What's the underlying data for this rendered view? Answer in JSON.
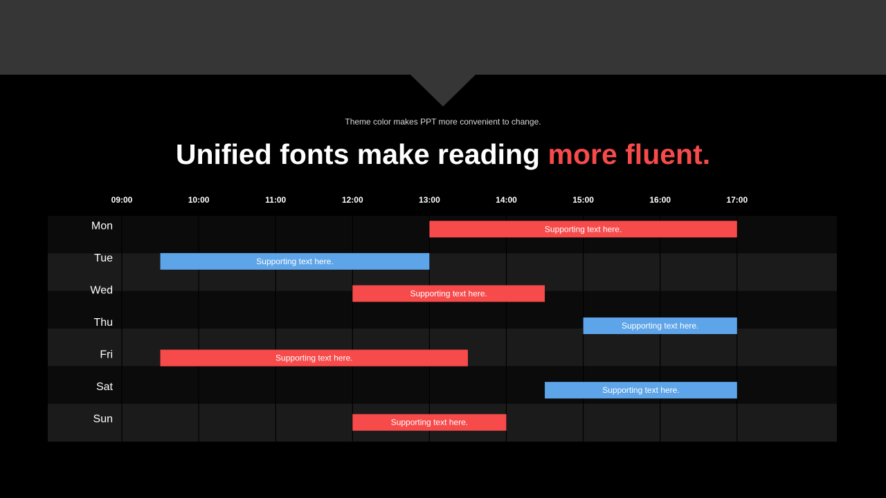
{
  "slide": {
    "subtitle": "Theme color makes PPT more convenient to change.",
    "title_plain": "Unified fonts make reading ",
    "title_accent": "more fluent."
  },
  "colors": {
    "accent_red": "#f74a4b",
    "accent_blue": "#5ea4e8",
    "band_dark": "#0b0b0b",
    "band_light": "#1b1b1b",
    "header_band": "#363636"
  },
  "chart_data": {
    "type": "gantt",
    "title": "Unified fonts make reading more fluent.",
    "x_ticks": [
      "09:00",
      "10:00",
      "11:00",
      "12:00",
      "13:00",
      "14:00",
      "15:00",
      "16:00",
      "17:00"
    ],
    "x_range": [
      9,
      18
    ],
    "categories": [
      "Mon",
      "Tue",
      "Wed",
      "Thu",
      "Fri",
      "Sat",
      "Sun"
    ],
    "bars": [
      {
        "day": "Mon",
        "start": "13:00",
        "end": "17:00",
        "label": "Supporting text here.",
        "color": "red"
      },
      {
        "day": "Tue",
        "start": "09:30",
        "end": "13:00",
        "label": "Supporting text here.",
        "color": "blue"
      },
      {
        "day": "Wed",
        "start": "12:00",
        "end": "14:30",
        "label": "Supporting text here.",
        "color": "red"
      },
      {
        "day": "Thu",
        "start": "15:00",
        "end": "17:00",
        "label": "Supporting text here.",
        "color": "blue"
      },
      {
        "day": "Fri",
        "start": "09:30",
        "end": "13:30",
        "label": "Supporting text here.",
        "color": "red"
      },
      {
        "day": "Sat",
        "start": "14:30",
        "end": "17:00",
        "label": "Supporting text here.",
        "color": "blue"
      },
      {
        "day": "Sun",
        "start": "12:00",
        "end": "14:00",
        "label": "Supporting text here.",
        "color": "red"
      }
    ]
  }
}
